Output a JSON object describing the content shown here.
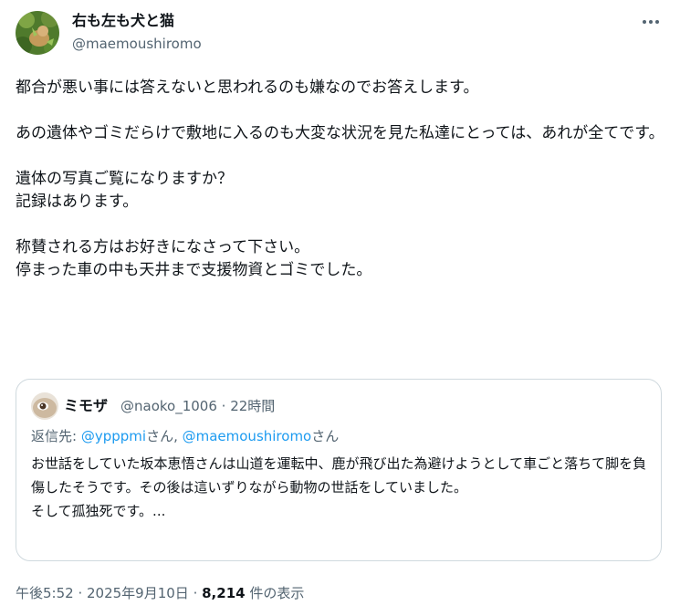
{
  "author": {
    "name": "右も左も犬と猫",
    "handle": "@maemoushiromo"
  },
  "tweet": {
    "text": "都合が悪い事には答えないと思われるのも嫌なのでお答えします。\n\nあの遺体やゴミだらけで敷地に入るのも大変な状況を見た私達にとっては、あれが全てです。\n\n遺体の写真ご覧になりますか？\n記録はあります。\n\n称賛される方はお好きになさって下さい。\n停まった車の中も天井まで支援物資とゴミでした。"
  },
  "quote": {
    "name": "ミモザ",
    "handle": "@naoko_1006",
    "separator": " · ",
    "time": "22時間",
    "reply_prefix": "返信先: ",
    "reply_mention_1": "@ypppmi",
    "reply_san_1": "さん, ",
    "reply_mention_2": "@maemoushiromo",
    "reply_san_2": "さん",
    "text": "お世話をしていた坂本恵悟さんは山道を運転中、鹿が飛び出た為避けようとして車ごと落ちて脚を負傷したそうです。その後は這いずりながら動物の世話をしていました。\nそして孤独死です。..."
  },
  "footer": {
    "time": "午後5:52",
    "sep1": " · ",
    "date": "2025年9月10日",
    "sep2": " · ",
    "views_count": "8,214",
    "views_label": " 件の表示"
  },
  "icons": {
    "more": "more-horizontal-icon",
    "avatar": "avatar-photo",
    "quote_avatar": "quote-avatar-photo"
  },
  "colors": {
    "text": "#0f1419",
    "secondary": "#536471",
    "link": "#1d9bf0",
    "border": "#cfd9de"
  }
}
